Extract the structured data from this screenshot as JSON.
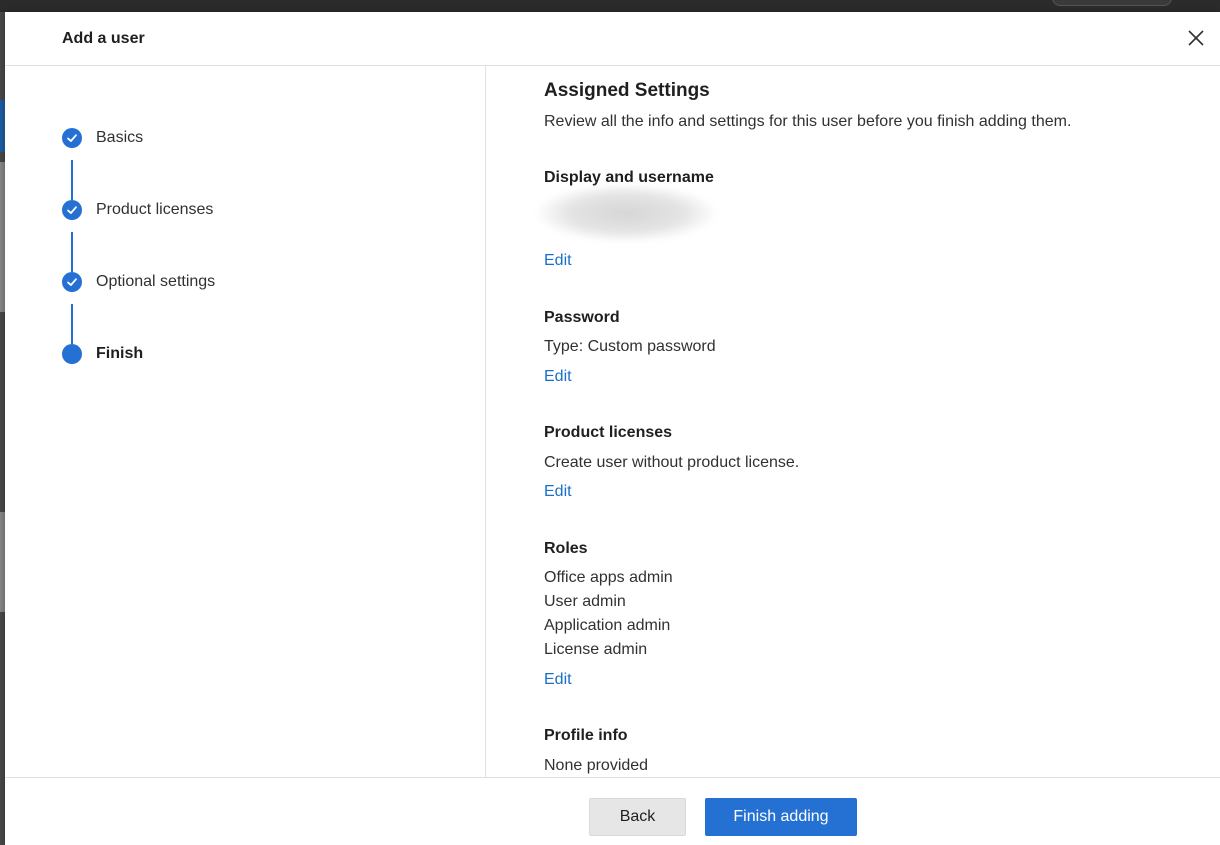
{
  "dialog": {
    "title": "Add a user"
  },
  "steps": [
    {
      "label": "Basics",
      "status": "complete"
    },
    {
      "label": "Product licenses",
      "status": "complete"
    },
    {
      "label": "Optional settings",
      "status": "complete"
    },
    {
      "label": "Finish",
      "status": "current"
    }
  ],
  "review": {
    "heading": "Assigned Settings",
    "intro": "Review all the info and settings for this user before you finish adding them.",
    "display": {
      "title": "Display and username",
      "edit": "Edit"
    },
    "password": {
      "title": "Password",
      "text": "Type: Custom password",
      "edit": "Edit"
    },
    "licenses": {
      "title": "Product licenses",
      "text": "Create user without product license.",
      "edit": "Edit"
    },
    "roles": {
      "title": "Roles",
      "items": [
        "Office apps admin",
        "User admin",
        "Application admin",
        "License admin"
      ],
      "edit": "Edit"
    },
    "profile": {
      "title": "Profile info",
      "text": "None provided"
    }
  },
  "footer": {
    "back_label": "Back",
    "finish_label": "Finish adding"
  },
  "colors": {
    "accent": "#2570d3",
    "link": "#1a6fc9"
  },
  "icons": {
    "close": "close-icon",
    "step_complete": "checkmark-icon"
  }
}
